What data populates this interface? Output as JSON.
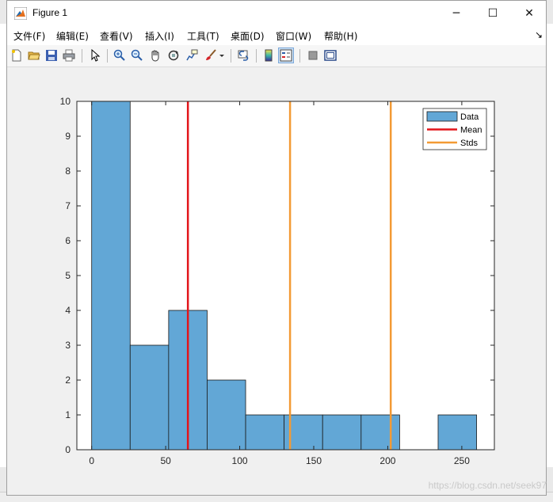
{
  "window": {
    "title": "Figure 1",
    "minimize_glyph": "─",
    "maximize_glyph": "☐",
    "close_glyph": "✕"
  },
  "menu": {
    "items": [
      "文件(F)",
      "编辑(E)",
      "查看(V)",
      "插入(I)",
      "工具(T)",
      "桌面(D)",
      "窗口(W)",
      "帮助(H)"
    ],
    "dock_arrow": "↘"
  },
  "toolbar": {
    "icons": [
      "new-figure-icon",
      "open-file-icon",
      "save-icon",
      "print-icon",
      "select-arrow-icon",
      "zoom-in-icon",
      "zoom-out-icon",
      "pan-hand-icon",
      "rotate-3d-icon",
      "data-cursor-icon",
      "brush-icon",
      "link-plot-icon",
      "colorbar-icon",
      "legend-icon",
      "hide-plot-tools-icon",
      "show-plot-tools-icon"
    ]
  },
  "watermark": "https://blog.csdn.net/seek97",
  "chart_data": {
    "type": "bar",
    "subtype": "histogram",
    "bin_edges": [
      0,
      26,
      52,
      78,
      104,
      130,
      156,
      182,
      208,
      234,
      260
    ],
    "counts": [
      10,
      3,
      4,
      2,
      1,
      1,
      1,
      1,
      0,
      1
    ],
    "bar_color": "#62a7d6",
    "xlim": [
      -10,
      272
    ],
    "ylim": [
      0,
      10
    ],
    "xticks": [
      0,
      50,
      100,
      150,
      200,
      250
    ],
    "yticks": [
      0,
      1,
      2,
      3,
      4,
      5,
      6,
      7,
      8,
      9,
      10
    ],
    "vlines": [
      {
        "series": "Mean",
        "x": 65,
        "color": "#e3151a"
      },
      {
        "series": "Stds",
        "x": 134,
        "color": "#f39a34"
      },
      {
        "series": "Stds",
        "x": 202,
        "color": "#f39a34"
      }
    ],
    "legend": {
      "position": "top-right",
      "entries": [
        {
          "label": "Data",
          "kind": "patch",
          "color": "#62a7d6"
        },
        {
          "label": "Mean",
          "kind": "line",
          "color": "#e3151a"
        },
        {
          "label": "Stds",
          "kind": "line",
          "color": "#f39a34"
        }
      ]
    },
    "grid": false
  }
}
